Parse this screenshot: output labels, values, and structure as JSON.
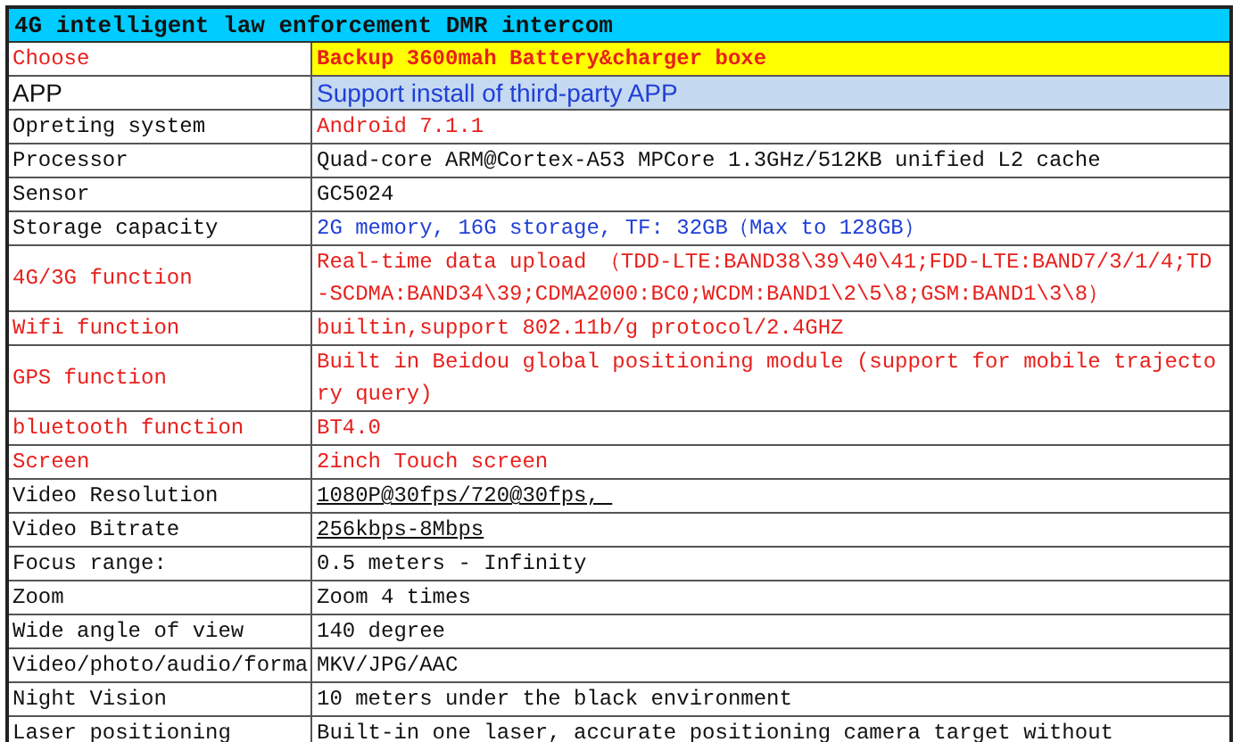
{
  "title": "4G intelligent law enforcement DMR intercom",
  "rows": [
    {
      "label": "Choose",
      "value": "Backup 3600mah Battery&charger boxe",
      "kind": "highlight"
    },
    {
      "label": "APP",
      "value": "Support install of third-party APP",
      "kind": "app"
    },
    {
      "label": "Opreting system",
      "value": "Android 7.1.1",
      "kind": "red_value"
    },
    {
      "label": "Processor",
      "value": "Quad-core ARM@Cortex-A53 MPCore 1.3GHz/512KB unified L2 cache",
      "kind": "plain"
    },
    {
      "label": "Sensor",
      "value": "GC5024",
      "kind": "plain"
    },
    {
      "label": "Storage capacity",
      "value": "2G memory, 16G storage, TF: 32GB（Max to 128GB）",
      "kind": "blue_value"
    },
    {
      "label": "4G/3G function",
      "value": "Real-time data upload （TDD-LTE:BAND38\\39\\40\\41;FDD-LTE:BAND7/3/1/4;TD-SCDMA:BAND34\\39;CDMA2000:BC0;WCDM:BAND1\\2\\5\\8;GSM:BAND1\\3\\8）",
      "kind": "red"
    },
    {
      "label": "Wifi function",
      "value": "builtin,support 802.11b/g protocol/2.4GHZ",
      "kind": "red"
    },
    {
      "label": "GPS function",
      "value": "Built in Beidou global positioning module (support for mobile trajectory query)",
      "kind": "red"
    },
    {
      "label": "bluetooth function",
      "value": "BT4.0",
      "kind": "red"
    },
    {
      "label": "Screen",
      "value": "2inch Touch screen",
      "kind": "red"
    },
    {
      "label": "Video Resolution",
      "value": "1080P@30fps/720@30fps, ",
      "kind": "underlined"
    },
    {
      "label": "Video Bitrate",
      "value": "256kbps-8Mbps",
      "kind": "underlined"
    },
    {
      "label": "Focus range:",
      "value": "0.5 meters - Infinity",
      "kind": "plain"
    },
    {
      "label": "Zoom",
      "value": "Zoom 4 times",
      "kind": "plain"
    },
    {
      "label": "Wide angle of view",
      "value": "140 degree",
      "kind": "plain"
    },
    {
      "label": "Video/photo/audio/forma",
      "value": "MKV/JPG/AAC",
      "kind": "plain"
    },
    {
      "label": "Night Vision",
      "value": "10 meters under the black environment",
      "kind": "plain"
    },
    {
      "label": "Laser positioning",
      "value": "Built-in one laser, accurate positioning camera target without",
      "kind": "plain"
    }
  ]
}
